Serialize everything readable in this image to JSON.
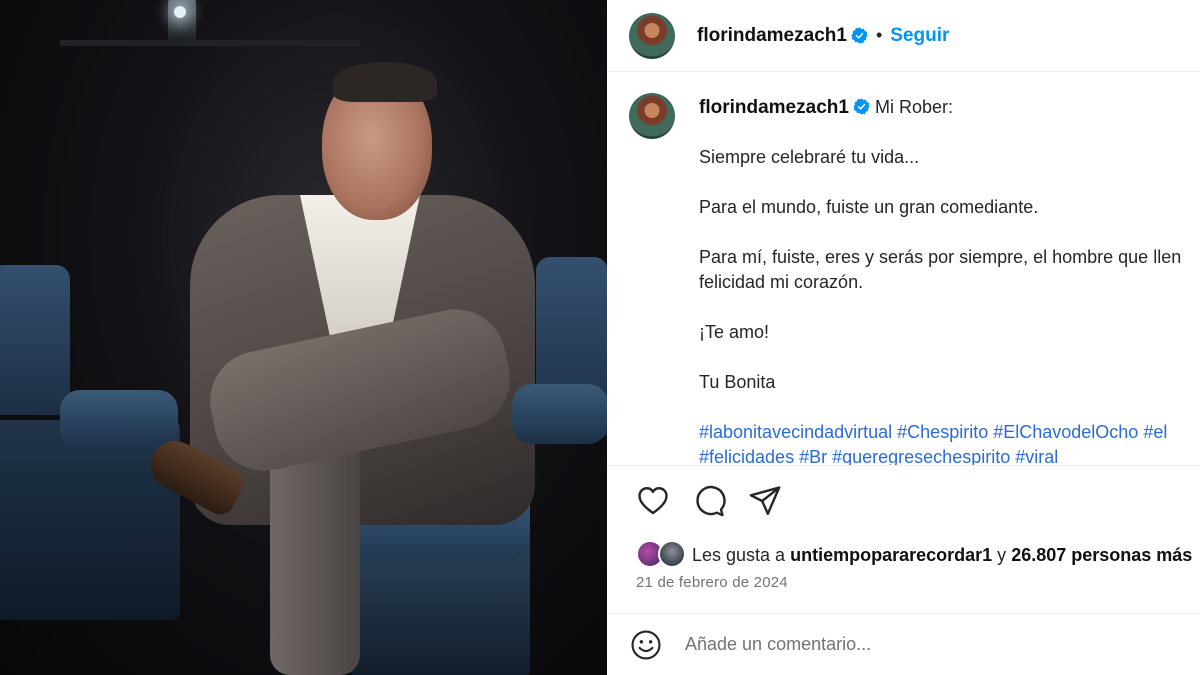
{
  "post": {
    "username": "florindamezach1",
    "follow_label": "Seguir",
    "dot": "•",
    "caption": {
      "greeting": "Mi Rober:",
      "lines": [
        "Siempre celebraré tu vida...",
        "Para el mundo, fuiste un gran comediante.",
        "Para mí, fuiste, eres y serás por siempre, el hombre que llen",
        "felicidad mi corazón.",
        "¡Te amo!",
        "Tu Bonita"
      ],
      "hashtags_line1": [
        "#labonitavecindadvirtual",
        "#Chespirito",
        "#ElChavodelOcho",
        "#el"
      ],
      "hashtags_line2": [
        "#felicidades",
        "#Br",
        "#queregresechespirito",
        "#viral"
      ]
    },
    "likes": {
      "prefix": "Les gusta a",
      "user": "untiempopararecordar1",
      "joiner": "y",
      "count_text": "26.807 personas más"
    },
    "date": "21 de febrero de 2024",
    "comment_placeholder": "Añade un comentario..."
  },
  "colors": {
    "follow": "#0095f6",
    "verified": "#0095f6",
    "hashtag": "#2b6bd8"
  },
  "icons": [
    "heart-icon",
    "comment-icon",
    "share-icon",
    "emoji-icon",
    "verified-badge-icon"
  ]
}
